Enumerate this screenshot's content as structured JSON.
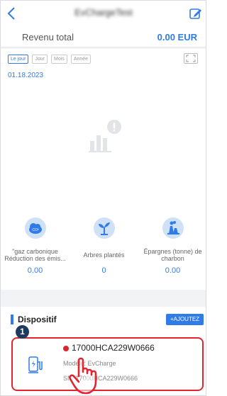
{
  "header": {
    "title": "EvChargeTest",
    "back_icon": "chevron-left-icon",
    "edit_icon": "edit-icon"
  },
  "revenue": {
    "label": "Revenu total",
    "value": "0.00 EUR"
  },
  "chart": {
    "tabs": [
      {
        "label": "Le jour",
        "active": true
      },
      {
        "label": "Jour",
        "active": false
      },
      {
        "label": "Mois",
        "active": false
      },
      {
        "label": "Année",
        "active": false
      }
    ],
    "date": "01.18.2023",
    "empty_icon": "empty-chart-icon",
    "expand_icon": "expand-icon"
  },
  "environment": [
    {
      "icon": "co2-icon",
      "label_line1": "\"gaz carbonique",
      "label_line2": "Réduction des émis...",
      "value": "0.00"
    },
    {
      "icon": "tree-icon",
      "label_line1": "Arbres plantés",
      "label_line2": "",
      "value": "0"
    },
    {
      "icon": "factory-icon",
      "label_line1": "Épargnes (tonne) de",
      "label_line2": "charbon",
      "value": "0.00"
    }
  ],
  "devices": {
    "title": "Dispositif",
    "add_label": "+AJOUTEZ",
    "items": [
      {
        "serial": "17000HCA229W0666",
        "model": "Modèle: EvCharge",
        "sn": "SN: 17000HCA229W0666",
        "status_color": "#d9262f"
      }
    ]
  },
  "annotation": {
    "step": "1"
  },
  "colors": {
    "accent": "#2f7bea",
    "highlight": "#e0252f"
  }
}
